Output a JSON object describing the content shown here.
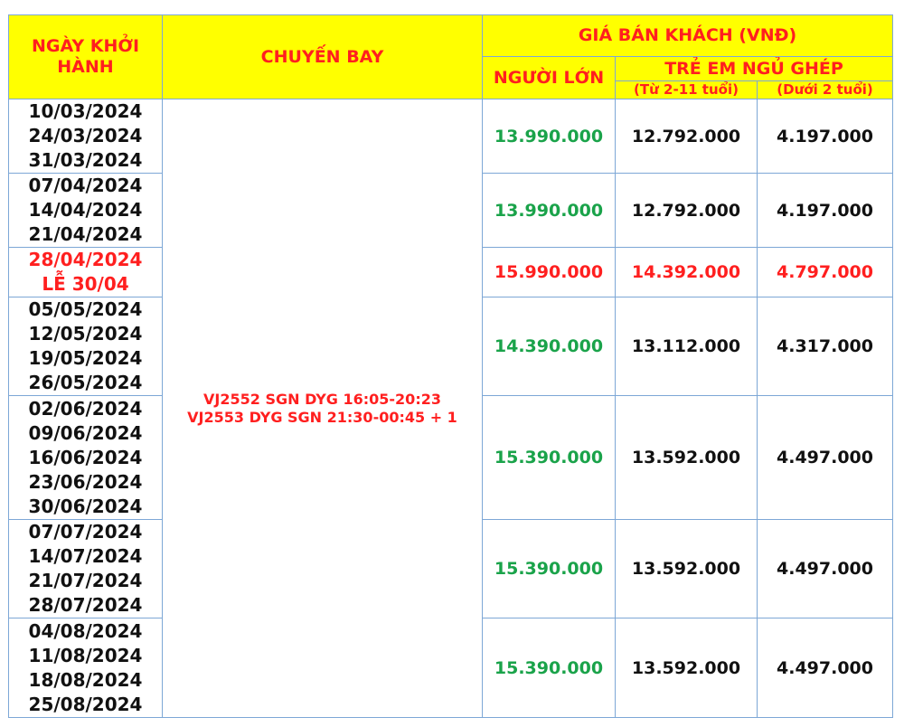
{
  "header": {
    "departure_date": "NGÀY KHỞI HÀNH",
    "flight": "CHUYẾN BAY",
    "price_group": "GIÁ BÁN KHÁCH (VNĐ)",
    "adult": "NGƯỜI LỚN",
    "child_group": "TRẺ EM NGỦ GHÉP",
    "child_2_11": "(Từ 2-11 tuổi)",
    "infant": "(Dưới 2 tuổi)"
  },
  "flight": {
    "line1": "VJ2552 SGN DYG 16:05-20:23",
    "line2": "VJ2553 DYG SGN 21:30-00:45 + 1"
  },
  "colors": {
    "header_bg": "#ffff00",
    "header_text": "#ff1f1f",
    "adult_price": "#1aa34a",
    "highlight_row": "#ff1f1f",
    "border": "#7da7d6"
  },
  "rows": [
    {
      "dates": [
        "10/03/2024",
        "24/03/2024",
        "31/03/2024"
      ],
      "adult": "13.990.000",
      "child": "12.792.000",
      "infant": "4.197.000"
    },
    {
      "dates": [
        "07/04/2024",
        "14/04/2024",
        "21/04/2024"
      ],
      "adult": "13.990.000",
      "child": "12.792.000",
      "infant": "4.197.000"
    },
    {
      "dates": [
        "28/04/2024",
        "LỄ 30/04"
      ],
      "adult": "15.990.000",
      "child": "14.392.000",
      "infant": "4.797.000"
    },
    {
      "dates": [
        "05/05/2024",
        "12/05/2024",
        "19/05/2024",
        "26/05/2024"
      ],
      "adult": "14.390.000",
      "child": "13.112.000",
      "infant": "4.317.000"
    },
    {
      "dates": [
        "02/06/2024",
        "09/06/2024",
        "16/06/2024",
        "23/06/2024",
        "30/06/2024"
      ],
      "adult": "15.390.000",
      "child": "13.592.000",
      "infant": "4.497.000"
    },
    {
      "dates": [
        "07/07/2024",
        "14/07/2024",
        "21/07/2024",
        "28/07/2024"
      ],
      "adult": "15.390.000",
      "child": "13.592.000",
      "infant": "4.497.000"
    },
    {
      "dates": [
        "04/08/2024",
        "11/08/2024",
        "18/08/2024",
        "25/08/2024"
      ],
      "adult": "15.390.000",
      "child": "13.592.000",
      "infant": "4.497.000"
    }
  ]
}
